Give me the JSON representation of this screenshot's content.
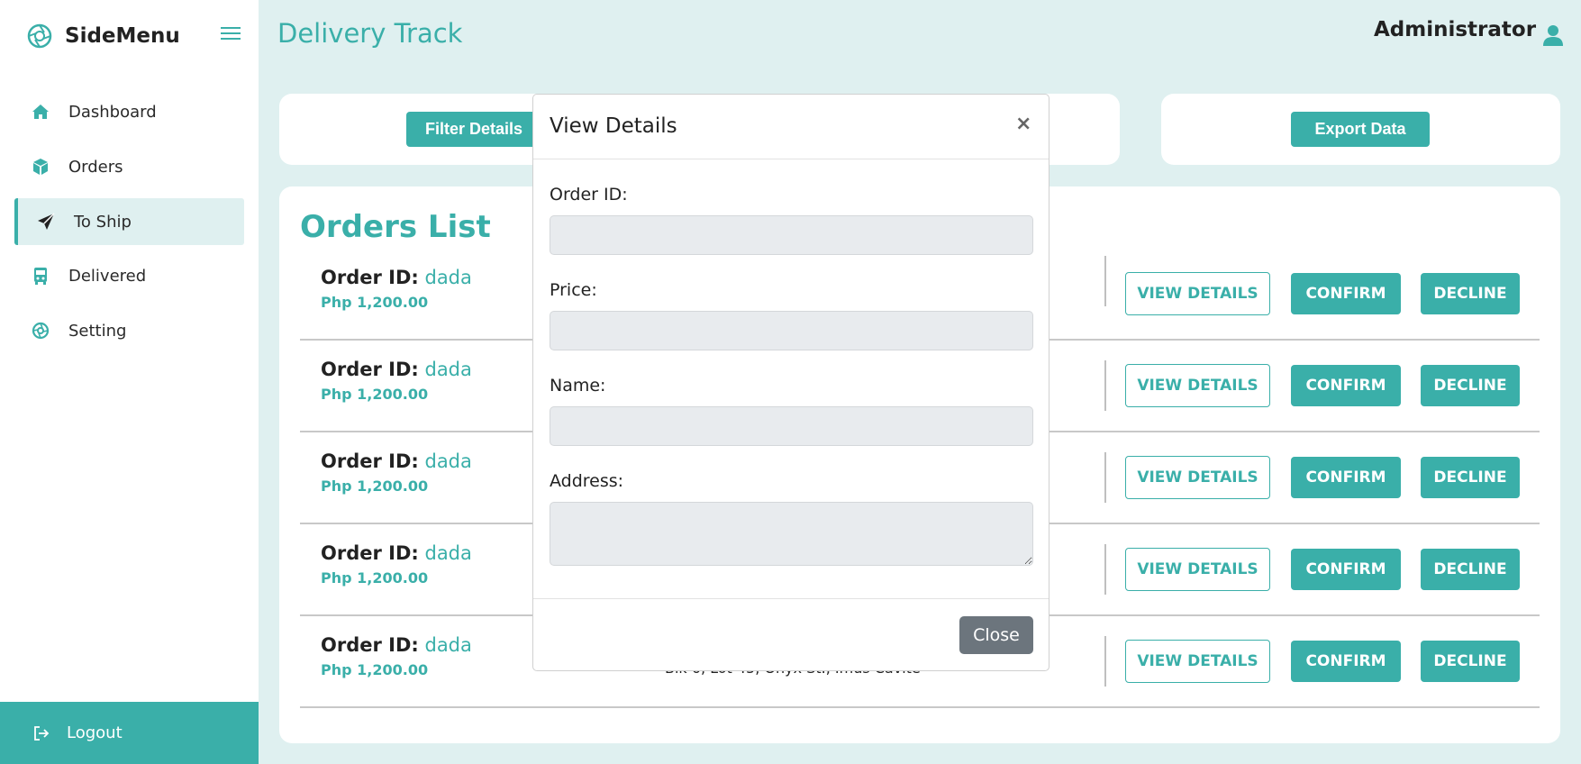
{
  "sidebar": {
    "brand": "SideMenu",
    "items": [
      {
        "label": "Dashboard",
        "icon": "home-icon"
      },
      {
        "label": "Orders",
        "icon": "box-icon"
      },
      {
        "label": "To Ship",
        "icon": "paper-plane-icon",
        "active": true
      },
      {
        "label": "Delivered",
        "icon": "bus-icon"
      },
      {
        "label": "Setting",
        "icon": "settings-icon"
      }
    ],
    "logout": "Logout"
  },
  "header": {
    "title": "Delivery Track",
    "user": "Administrator"
  },
  "toolbar": {
    "filter_label": "Filter Details",
    "export_label": "Export Data"
  },
  "orders": {
    "title": "Orders List",
    "id_label": "Order ID:",
    "view_label": "VIEW DETAILS",
    "confirm_label": "CONFIRM",
    "decline_label": "DECLINE",
    "rows": [
      {
        "id": "dada",
        "price": "Php 1,200.00"
      },
      {
        "id": "dada",
        "price": "Php 1,200.00"
      },
      {
        "id": "dada",
        "price": "Php 1,200.00"
      },
      {
        "id": "dada",
        "price": "Php 1,200.00"
      },
      {
        "id": "dada",
        "price": "Php 1,200.00",
        "address": "Blk 6, Lot 45, Onyx St., Imus Cavite"
      }
    ]
  },
  "modal": {
    "title": "View Details",
    "close_x": "×",
    "fields": [
      {
        "label": "Order ID:",
        "value": ""
      },
      {
        "label": "Price:",
        "value": ""
      },
      {
        "label": "Name:",
        "value": ""
      },
      {
        "label": "Address:",
        "value": ""
      }
    ],
    "close_label": "Close"
  },
  "colors": {
    "accent": "#3aafa9",
    "background": "#dff0f0",
    "close_button": "#6c757d"
  }
}
